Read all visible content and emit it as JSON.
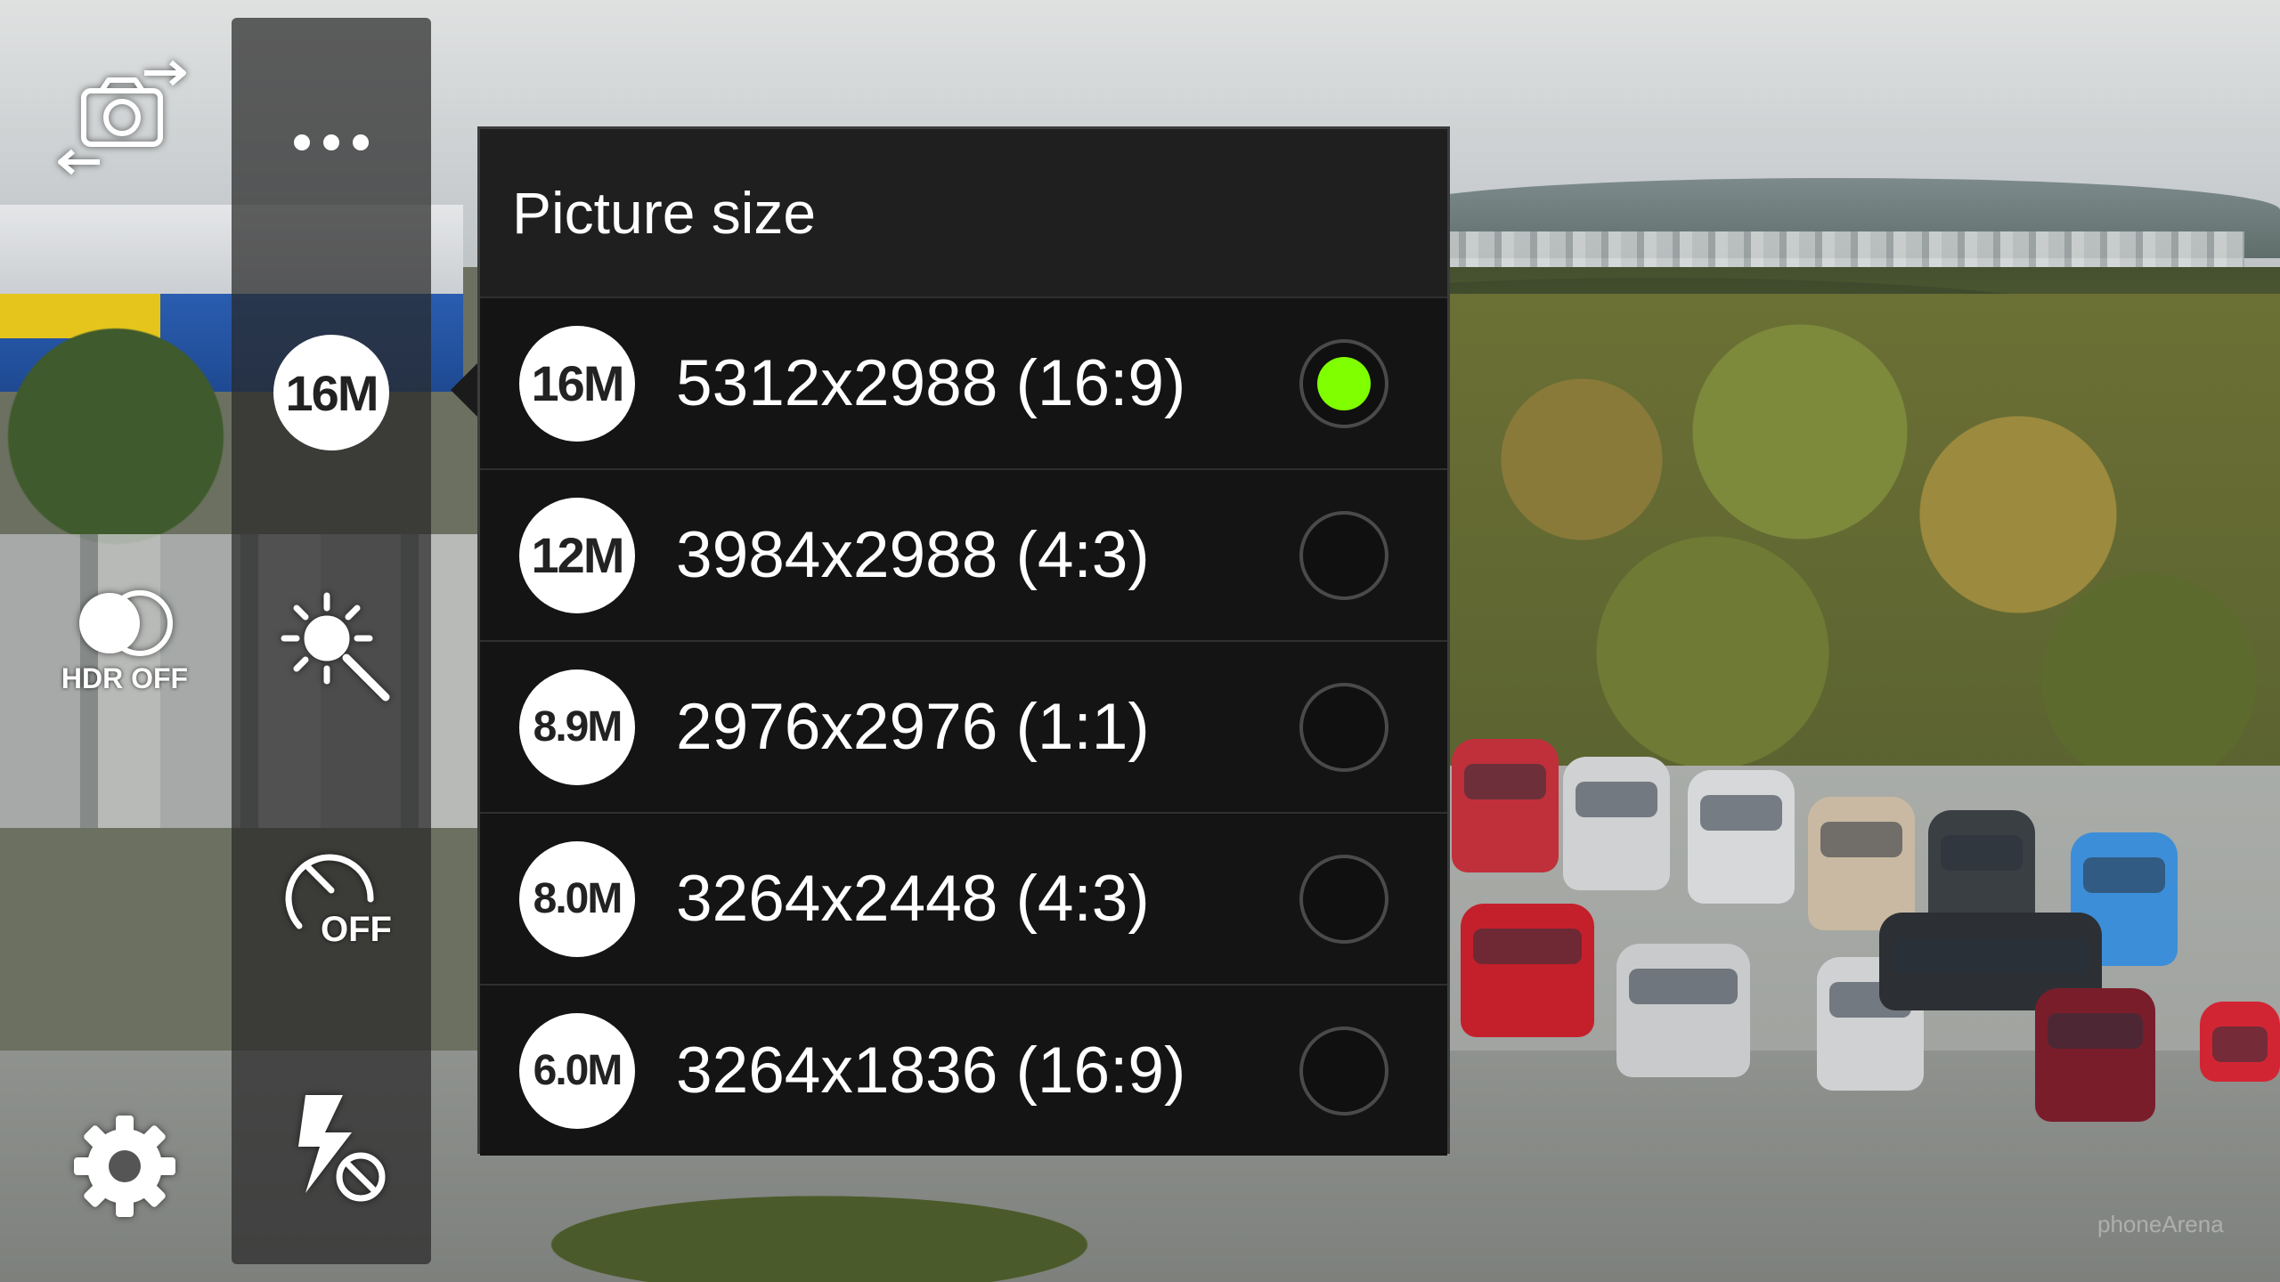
{
  "sidebar": {
    "more_label": "•••",
    "resolution_label": "16M",
    "hdr_label": "HDR OFF",
    "timer_label": "OFF"
  },
  "dialog": {
    "title": "Picture size",
    "options": [
      {
        "badge": "16M",
        "label": "5312x2988 (16:9)",
        "selected": true
      },
      {
        "badge": "12M",
        "label": "3984x2988 (4:3)",
        "selected": false
      },
      {
        "badge": "8.9M",
        "label": "2976x2976 (1:1)",
        "selected": false
      },
      {
        "badge": "8.0M",
        "label": "3264x2448 (4:3)",
        "selected": false
      },
      {
        "badge": "6.0M",
        "label": "3264x1836 (16:9)",
        "selected": false
      }
    ]
  },
  "colors": {
    "selected_radio": "#7fff00",
    "dialog_bg": "#1b1b1b"
  },
  "icons": [
    "switch-camera-icon",
    "more-icon",
    "hdr-icon",
    "effects-icon",
    "timer-icon",
    "settings-icon",
    "flash-off-icon"
  ]
}
